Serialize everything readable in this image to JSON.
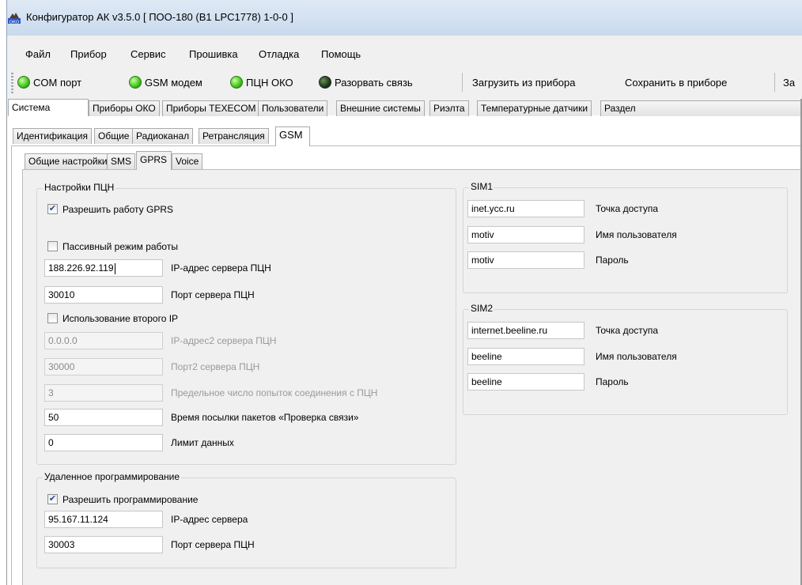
{
  "window": {
    "title": "Конфигуратор АК v3.5.0 [ ПОО-180 (B1 LPC1778) 1-0-0 ]",
    "icon": "oko-app-icon"
  },
  "menu": [
    "Файл",
    "Прибор",
    "Сервис",
    "Прошивка",
    "Отладка",
    "Помощь"
  ],
  "toolbar": {
    "com_port": "COM порт",
    "gsm_modem": "GSM модем",
    "ptsn_oko": "ПЦН ОКО",
    "disconnect": "Разорвать связь",
    "load_from_device": "Загрузить из прибора",
    "save_to_device": "Сохранить в приборе",
    "truncated": "За",
    "colors": {
      "connected": "#3ec21a",
      "disconnect": "#1a3a12"
    }
  },
  "tabs_level1": [
    "Система",
    "Приборы ОКО",
    "Приборы TEXECOM",
    "Пользователи",
    "Внешние системы",
    "Риэлта",
    "Температурные датчики",
    "Раздел"
  ],
  "tabs_level2": [
    "Идентификация",
    "Общие",
    "Радиоканал",
    "Ретрансляция",
    "GSM"
  ],
  "tabs_level3": [
    "Общие настройки",
    "SMS",
    "GPRS",
    "Voice"
  ],
  "ptsn_group": {
    "legend": "Настройки ПЦН",
    "enable_gprs": {
      "label": "Разрешить работу GPRS",
      "checked": true
    },
    "passive_mode": {
      "label": "Пассивный режим работы",
      "checked": false
    },
    "server_ip": {
      "value": "188.226.92.119",
      "label": "IP-адрес сервера ПЦН"
    },
    "server_port": {
      "value": "30010",
      "label": "Порт сервера ПЦН"
    },
    "second_ip_enabled": {
      "label": "Использование второго IP",
      "checked": false
    },
    "server_ip2": {
      "value": "0.0.0.0",
      "label": "IP-адрес2 сервера ПЦН"
    },
    "server_port2": {
      "value": "30000",
      "label": "Порт2 сервера ПЦН"
    },
    "max_attempts": {
      "value": "3",
      "label": "Предельное число попыток соединения с ПЦН"
    },
    "keepalive": {
      "value": "50",
      "label": "Время посылки пакетов «Проверка связи»"
    },
    "data_limit": {
      "value": "0",
      "label": "Лимит данных"
    }
  },
  "remote_group": {
    "legend": "Удаленное программирование",
    "enable_programming": {
      "label": "Разрешить программирование",
      "checked": true
    },
    "server_ip": {
      "value": "95.167.11.124",
      "label": "IP-адрес сервера"
    },
    "server_port": {
      "value": "30003",
      "label": "Порт сервера ПЦН"
    }
  },
  "sim1": {
    "legend": "SIM1",
    "apn": {
      "value": "inet.ycc.ru",
      "label": "Точка доступа"
    },
    "user": {
      "value": "motiv",
      "label": "Имя пользователя"
    },
    "password": {
      "value": "motiv",
      "label": "Пароль"
    }
  },
  "sim2": {
    "legend": "SIM2",
    "apn": {
      "value": "internet.beeline.ru",
      "label": "Точка доступа"
    },
    "user": {
      "value": "beeline",
      "label": "Имя пользователя"
    },
    "password": {
      "value": "beeline",
      "label": "Пароль"
    }
  }
}
